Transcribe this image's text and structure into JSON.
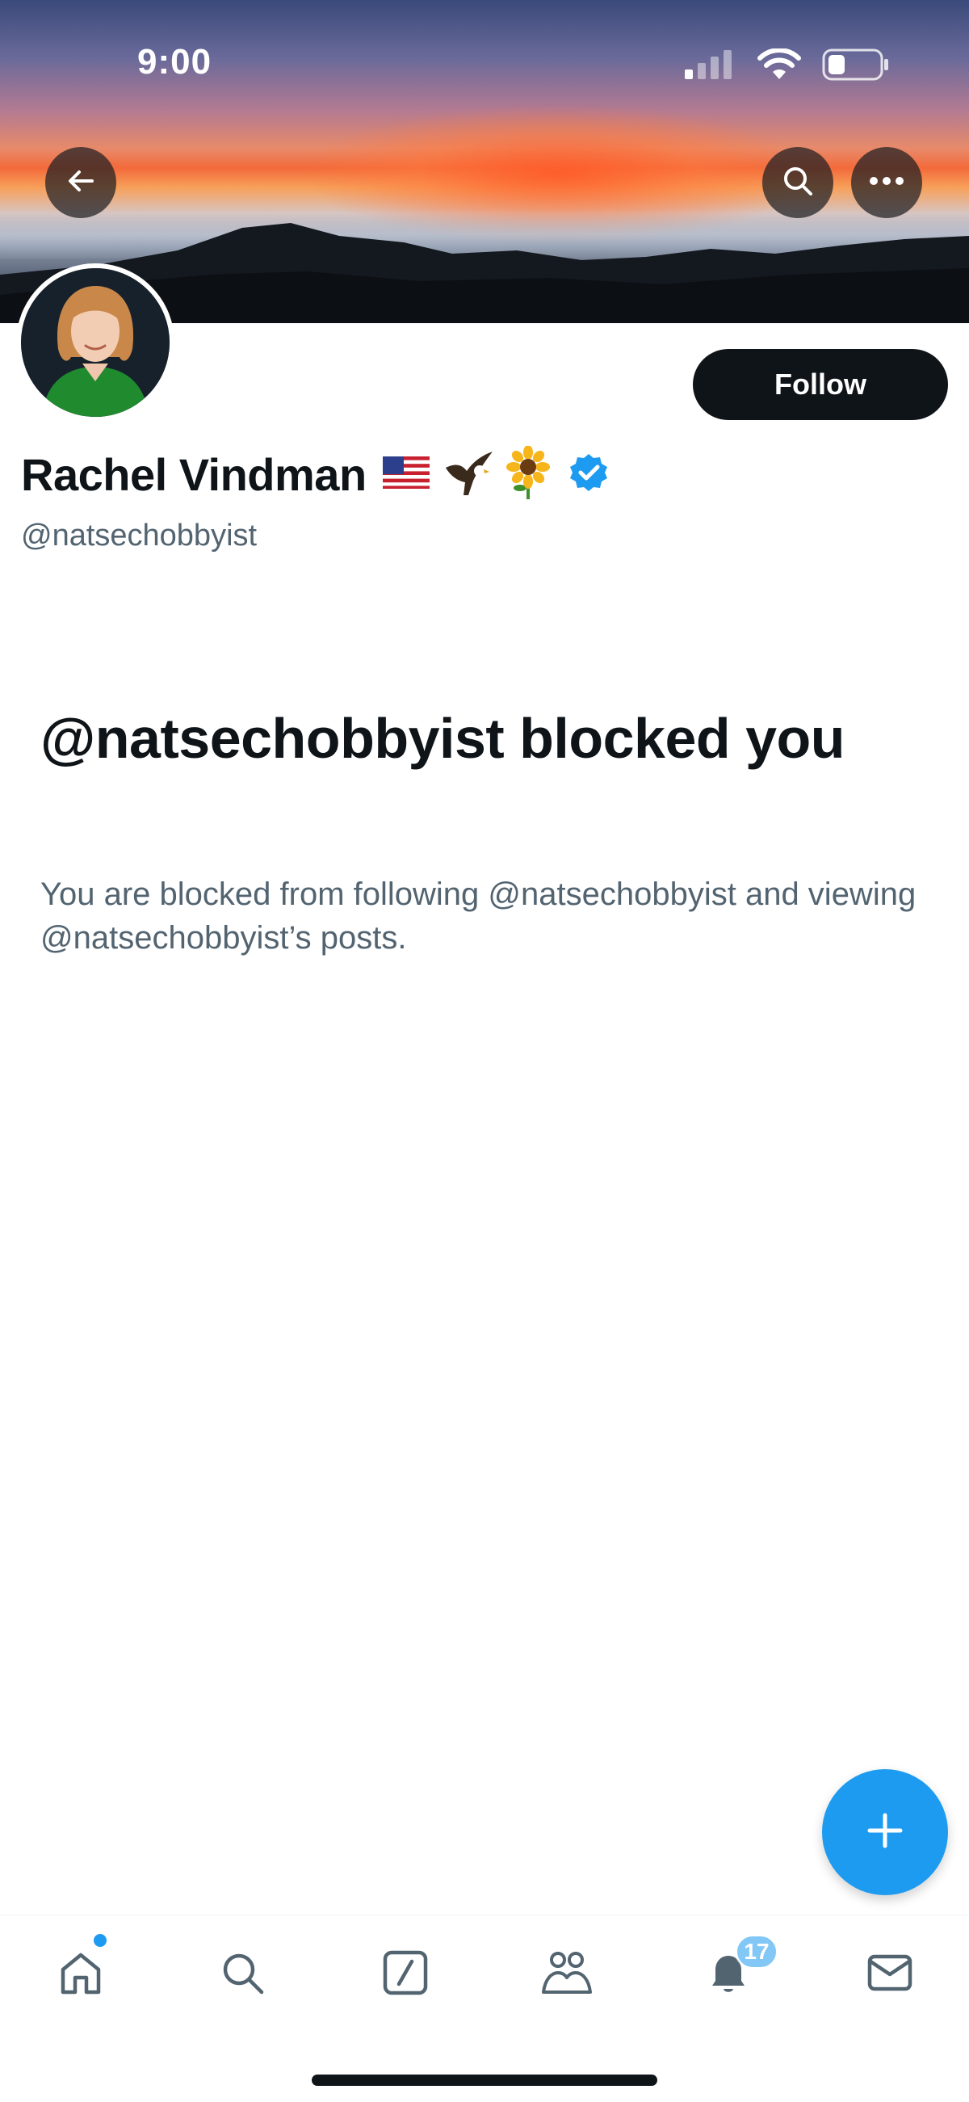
{
  "status_bar": {
    "time": "9:00",
    "icons": [
      "cellular-signal-icon",
      "wifi-icon",
      "battery-icon"
    ]
  },
  "profile": {
    "display_name": "Rachel Vindman",
    "name_emojis": [
      "🇺🇸",
      "🦅",
      "🌻"
    ],
    "verified": true,
    "handle": "@natsechobbyist",
    "follow_label": "Follow"
  },
  "blocked": {
    "title": "@natsechobbyist blocked you",
    "description": "You are blocked from following @natsechobbyist and viewing @natsechobbyist’s posts."
  },
  "bottom_nav": {
    "items": [
      "home-icon",
      "search-icon",
      "compose-icon",
      "communities-icon",
      "notifications-icon",
      "messages-icon"
    ],
    "notifications_count": "17"
  },
  "colors": {
    "accent": "#1d9bf0",
    "text_primary": "#0f1419",
    "text_secondary": "#536471"
  }
}
